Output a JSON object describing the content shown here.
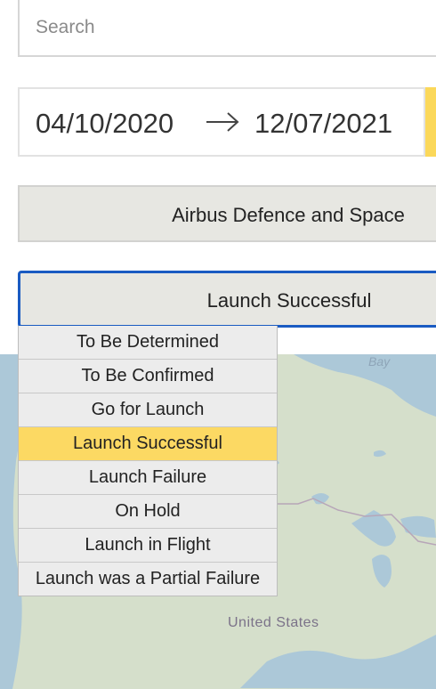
{
  "search": {
    "placeholder": "Search"
  },
  "date_range": {
    "start": "04/10/2020",
    "end": "12/07/2021"
  },
  "agency_filter": {
    "value": "Airbus Defence and Space"
  },
  "status_filter": {
    "value": "Launch Successful",
    "options": [
      "To Be Determined",
      "To Be Confirmed",
      "Go for Launch",
      "Launch Successful",
      "Launch Failure",
      "On Hold",
      "Launch in Flight",
      "Launch was a Partial Failure"
    ]
  },
  "map": {
    "country_label": "United States",
    "bay_label": "Bay"
  },
  "colors": {
    "accent_yellow": "#fcd963",
    "focus_blue": "#1a5bc2"
  }
}
